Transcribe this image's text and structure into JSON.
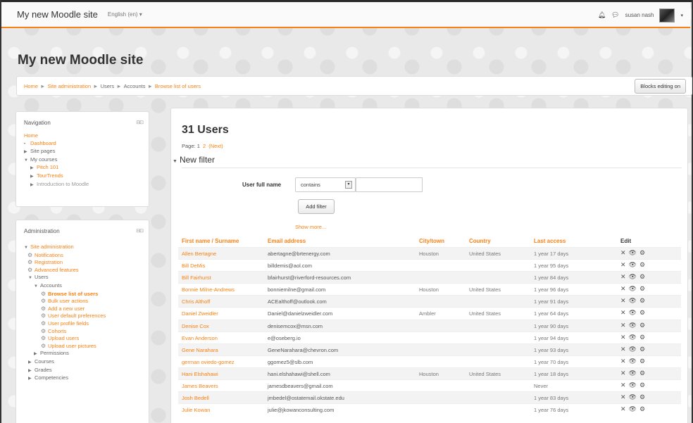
{
  "navbar": {
    "brand": "My new Moodle site",
    "language": "English (en) ▾",
    "notification_icon": "bell-icon",
    "message_icon": "speech-bubble-icon",
    "username": "susan nash",
    "caret": "▾"
  },
  "header": {
    "site_title": "My new Moodle site",
    "breadcrumb": [
      "Home",
      "Site administration",
      "Users",
      "Accounts",
      "Browse list of users"
    ],
    "blocks_editing_label": "Blocks editing on"
  },
  "navigation": {
    "title": "Navigation",
    "home": "Home",
    "dashboard": "Dashboard",
    "site_pages": "Site pages",
    "my_courses": "My courses",
    "courses": [
      "Pitch 101",
      "TourTrends",
      "Introduction to Moodle"
    ]
  },
  "administration": {
    "title": "Administration",
    "site_admin": "Site administration",
    "items": [
      "Notifications",
      "Registration",
      "Advanced features"
    ],
    "users": "Users",
    "accounts": "Accounts",
    "account_items": [
      "Browse list of users",
      "Bulk user actions",
      "Add a new user",
      "User default preferences",
      "User profile fields",
      "Cohorts",
      "Upload users",
      "Upload user pictures"
    ],
    "permissions": "Permissions",
    "courses": "Courses",
    "grades": "Grades",
    "competencies": "Competencies"
  },
  "main": {
    "heading": "31 Users",
    "page_label": "Page:",
    "page_current": "1",
    "page_2": "2",
    "page_next": "(Next)",
    "filter_legend": "New filter",
    "filter_label": "User full name",
    "filter_operator": "contains",
    "filter_value": "",
    "add_filter_label": "Add filter",
    "show_more": "Show more..."
  },
  "table": {
    "headers": [
      "First name / Surname",
      "Email address",
      "City/town",
      "Country",
      "Last access",
      "Edit"
    ],
    "edit_icons": [
      "delete-icon",
      "view-icon",
      "settings-icon"
    ],
    "rows": [
      {
        "name": "Allen Bertagne",
        "email": "abertagne@brtenergy.com",
        "city": "Houston",
        "country": "United States",
        "access": "1 year 17 days"
      },
      {
        "name": "Bill DeMis",
        "email": "billdemis@aol.com",
        "city": "",
        "country": "",
        "access": "1 year 95 days"
      },
      {
        "name": "Bill Fairhurst",
        "email": "bfairhurst@riverford-resources.com",
        "city": "",
        "country": "",
        "access": "1 year 84 days"
      },
      {
        "name": "Bonnie Milne-Andrews",
        "email": "bonniemilne@gmail.com",
        "city": "Houston",
        "country": "United States",
        "access": "1 year 96 days"
      },
      {
        "name": "Chris Althoff",
        "email": "ACEalthoff@outlook.com",
        "city": "",
        "country": "",
        "access": "1 year 91 days"
      },
      {
        "name": "Daniel Zweidler",
        "email": "Daniel@danielzweidler.com",
        "city": "Ambler",
        "country": "United States",
        "access": "1 year 64 days"
      },
      {
        "name": "Denise Cox",
        "email": "denisemcox@msn.com",
        "city": "",
        "country": "",
        "access": "1 year 90 days"
      },
      {
        "name": "Evan Anderson",
        "email": "e@oseberg.io",
        "city": "",
        "country": "",
        "access": "1 year 94 days"
      },
      {
        "name": "Gene Narahara",
        "email": "GeneNarahara@chevron.com",
        "city": "",
        "country": "",
        "access": "1 year 93 days"
      },
      {
        "name": "german oviedo-gomez",
        "email": "ggomez5@slb.com",
        "city": "",
        "country": "",
        "access": "1 year 70 days"
      },
      {
        "name": "Hani Elshahawi",
        "email": "hani.elshahawi@shell.com",
        "city": "Houston",
        "country": "United States",
        "access": "1 year 18 days"
      },
      {
        "name": "James Beavers",
        "email": "jamesdbeavers@gmail.com",
        "city": "",
        "country": "",
        "access": "Never"
      },
      {
        "name": "Josh Bedell",
        "email": "jmbedel@ostatemail.okstate.edu",
        "city": "",
        "country": "",
        "access": "1 year 83 days"
      },
      {
        "name": "Julie Kowan",
        "email": "julie@jkowanconsulting.com",
        "city": "",
        "country": "",
        "access": "1 year 76 days"
      }
    ]
  }
}
